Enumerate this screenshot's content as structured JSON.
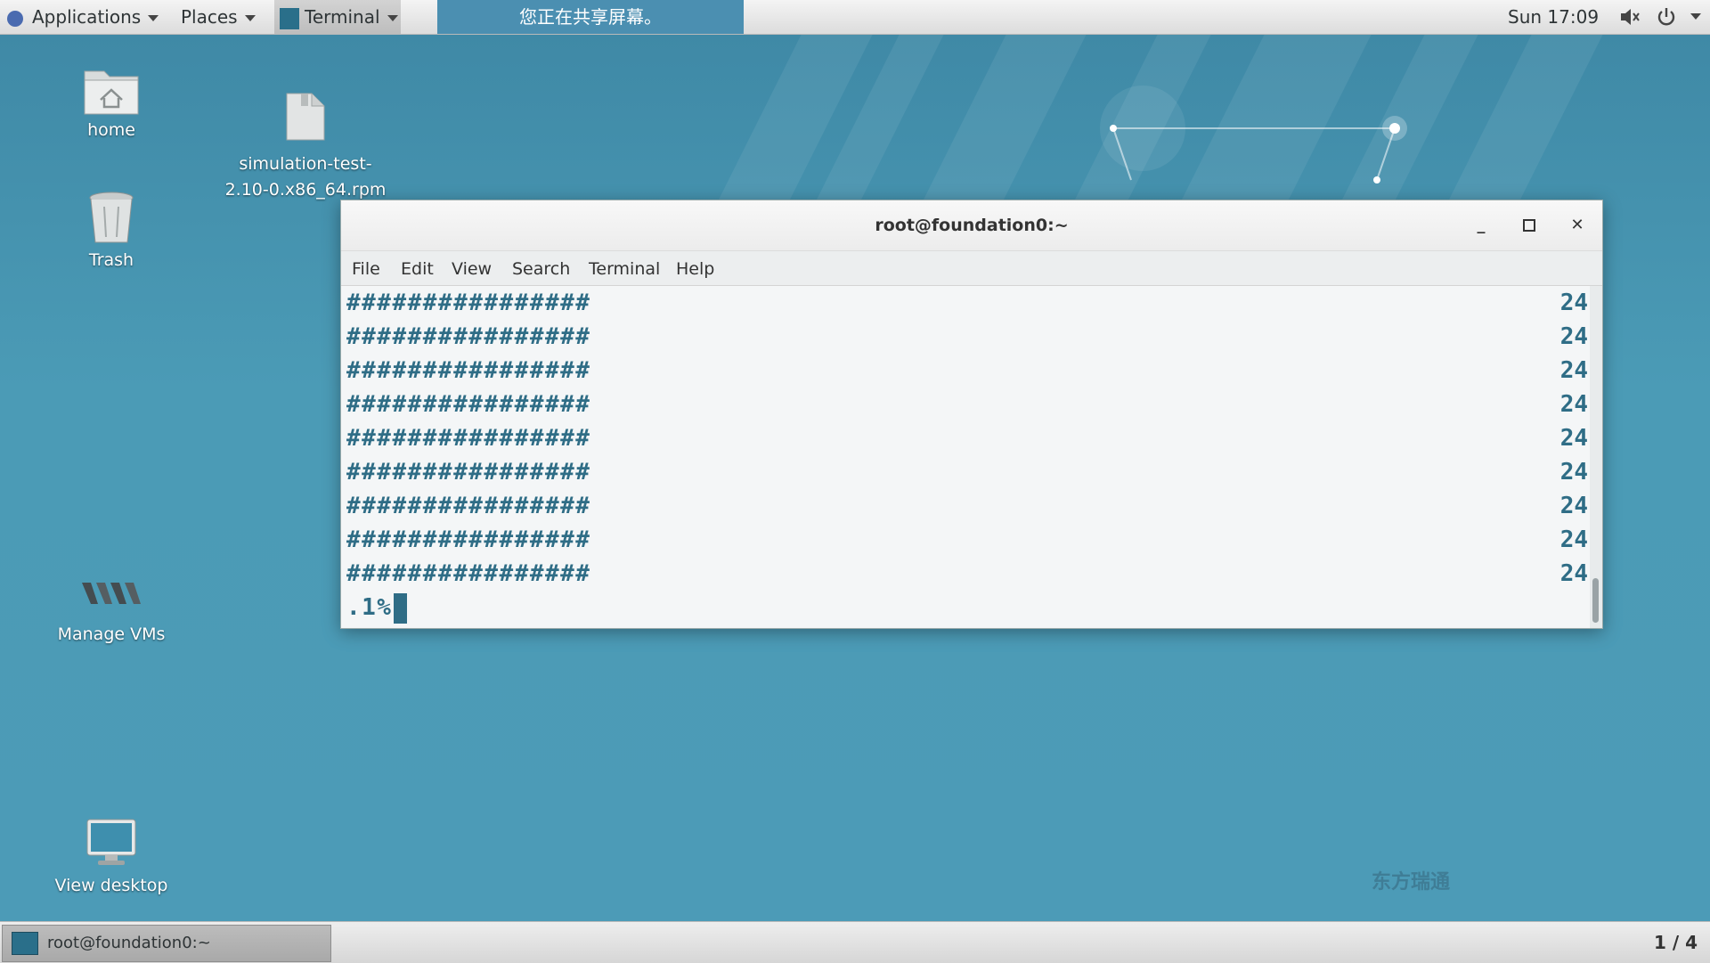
{
  "topbar": {
    "applications": "Applications",
    "places": "Places",
    "terminal": "Terminal",
    "banner": "您正在共享屏幕。",
    "clock": "Sun 17:09"
  },
  "desktop": {
    "icons": [
      {
        "label": "home",
        "icon": "home-folder-icon"
      },
      {
        "label": "simulation-test-\n2.10-0.x86_64.rpm",
        "icon": "package-file-icon"
      },
      {
        "label": "Trash",
        "icon": "trash-icon"
      },
      {
        "label": "Manage VMs",
        "icon": "vm-icon"
      },
      {
        "label": "View desktop",
        "icon": "monitor-icon"
      }
    ]
  },
  "window": {
    "title": "root@foundation0:~",
    "menu": [
      "File",
      "Edit",
      "View",
      "Search",
      "Terminal",
      "Help"
    ],
    "lines": [
      {
        "text": "################",
        "num": "24"
      },
      {
        "text": "################",
        "num": "24"
      },
      {
        "text": "################",
        "num": "24"
      },
      {
        "text": "################",
        "num": "24"
      },
      {
        "text": "################",
        "num": "24"
      },
      {
        "text": "################",
        "num": "24"
      },
      {
        "text": "################",
        "num": "24"
      },
      {
        "text": "################",
        "num": "24"
      },
      {
        "text": "################",
        "num": "24"
      }
    ],
    "prompt": ".1%"
  },
  "taskbar": {
    "item": "root@foundation0:~",
    "workspace": "1 / 4"
  },
  "watermark": "东方瑞通",
  "colors": {
    "accent": "#4b8fb1",
    "terminal_text": "#2f6d86",
    "desktop": "#4a98b4"
  }
}
